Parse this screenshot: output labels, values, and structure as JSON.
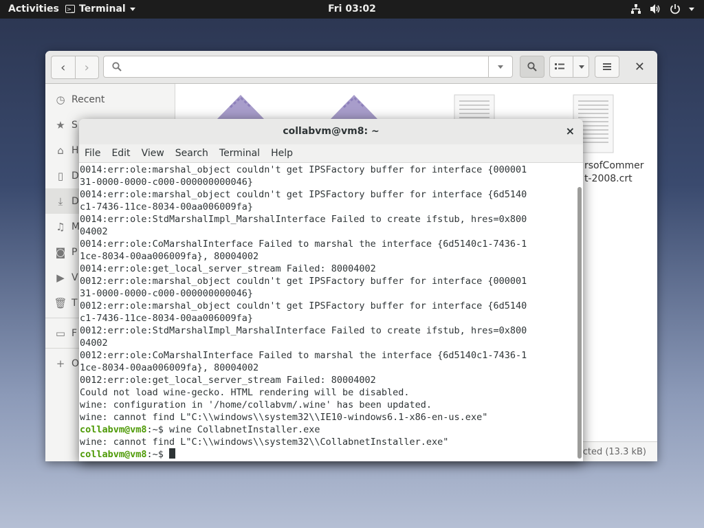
{
  "topbar": {
    "activities": "Activities",
    "app_name": "Terminal",
    "clock": "Fri 03:02"
  },
  "file_manager": {
    "sidebar": {
      "items": [
        {
          "label": "Recent",
          "icon": "clock-icon"
        },
        {
          "label": "S",
          "icon": "star-icon"
        },
        {
          "label": "H",
          "icon": "home-icon"
        },
        {
          "label": "D",
          "icon": "document-icon"
        },
        {
          "label": "D",
          "icon": "download-icon"
        },
        {
          "label": "M",
          "icon": "music-icon"
        },
        {
          "label": "P",
          "icon": "camera-icon"
        },
        {
          "label": "V",
          "icon": "video-icon"
        },
        {
          "label": "T",
          "icon": "trash-icon"
        },
        {
          "label": "F",
          "icon": "drive-icon"
        },
        {
          "label": "O",
          "icon": "plus-icon"
        }
      ]
    },
    "files": [
      {
        "name_line1": "rsofCommer",
        "name_line2": "t-2008.crt"
      }
    ],
    "status": "cted (13.3 kB)"
  },
  "terminal": {
    "title": "collabvm@vm8: ~",
    "close_glyph": "×",
    "menu": [
      "File",
      "Edit",
      "View",
      "Search",
      "Terminal",
      "Help"
    ],
    "lines": [
      {
        "text": "0014:err:ole:marshal_object couldn't get IPSFactory buffer for interface {000001"
      },
      {
        "text": "31-0000-0000-c000-000000000046}"
      },
      {
        "text": "0014:err:ole:marshal_object couldn't get IPSFactory buffer for interface {6d5140"
      },
      {
        "text": "c1-7436-11ce-8034-00aa006009fa}"
      },
      {
        "text": "0014:err:ole:StdMarshalImpl_MarshalInterface Failed to create ifstub, hres=0x800"
      },
      {
        "text": "04002"
      },
      {
        "text": "0014:err:ole:CoMarshalInterface Failed to marshal the interface {6d5140c1-7436-1"
      },
      {
        "text": "1ce-8034-00aa006009fa}, 80004002"
      },
      {
        "text": "0014:err:ole:get_local_server_stream Failed: 80004002"
      },
      {
        "text": "0012:err:ole:marshal_object couldn't get IPSFactory buffer for interface {000001"
      },
      {
        "text": "31-0000-0000-c000-000000000046}"
      },
      {
        "text": "0012:err:ole:marshal_object couldn't get IPSFactory buffer for interface {6d5140"
      },
      {
        "text": "c1-7436-11ce-8034-00aa006009fa}"
      },
      {
        "text": "0012:err:ole:StdMarshalImpl_MarshalInterface Failed to create ifstub, hres=0x800"
      },
      {
        "text": "04002"
      },
      {
        "text": "0012:err:ole:CoMarshalInterface Failed to marshal the interface {6d5140c1-7436-1"
      },
      {
        "text": "1ce-8034-00aa006009fa}, 80004002"
      },
      {
        "text": "0012:err:ole:get_local_server_stream Failed: 80004002"
      },
      {
        "text": "Could not load wine-gecko. HTML rendering will be disabled."
      },
      {
        "text": "wine: configuration in '/home/collabvm/.wine' has been updated."
      },
      {
        "text": "wine: cannot find L\"C:\\\\windows\\\\system32\\\\IE10-windows6.1-x86-en-us.exe\""
      },
      {
        "prompt": "collabvm@vm8",
        "text": ":~$ wine CollabnetInstaller.exe"
      },
      {
        "text": "wine: cannot find L\"C:\\\\windows\\\\system32\\\\CollabnetInstaller.exe\""
      },
      {
        "prompt": "collabvm@vm8",
        "text": ":~$ ",
        "cursor": true
      }
    ]
  },
  "colors": {
    "prompt_green": "#4e9a06",
    "terminal_text": "#2e3436",
    "topbar_bg": "#1c1c1c"
  }
}
